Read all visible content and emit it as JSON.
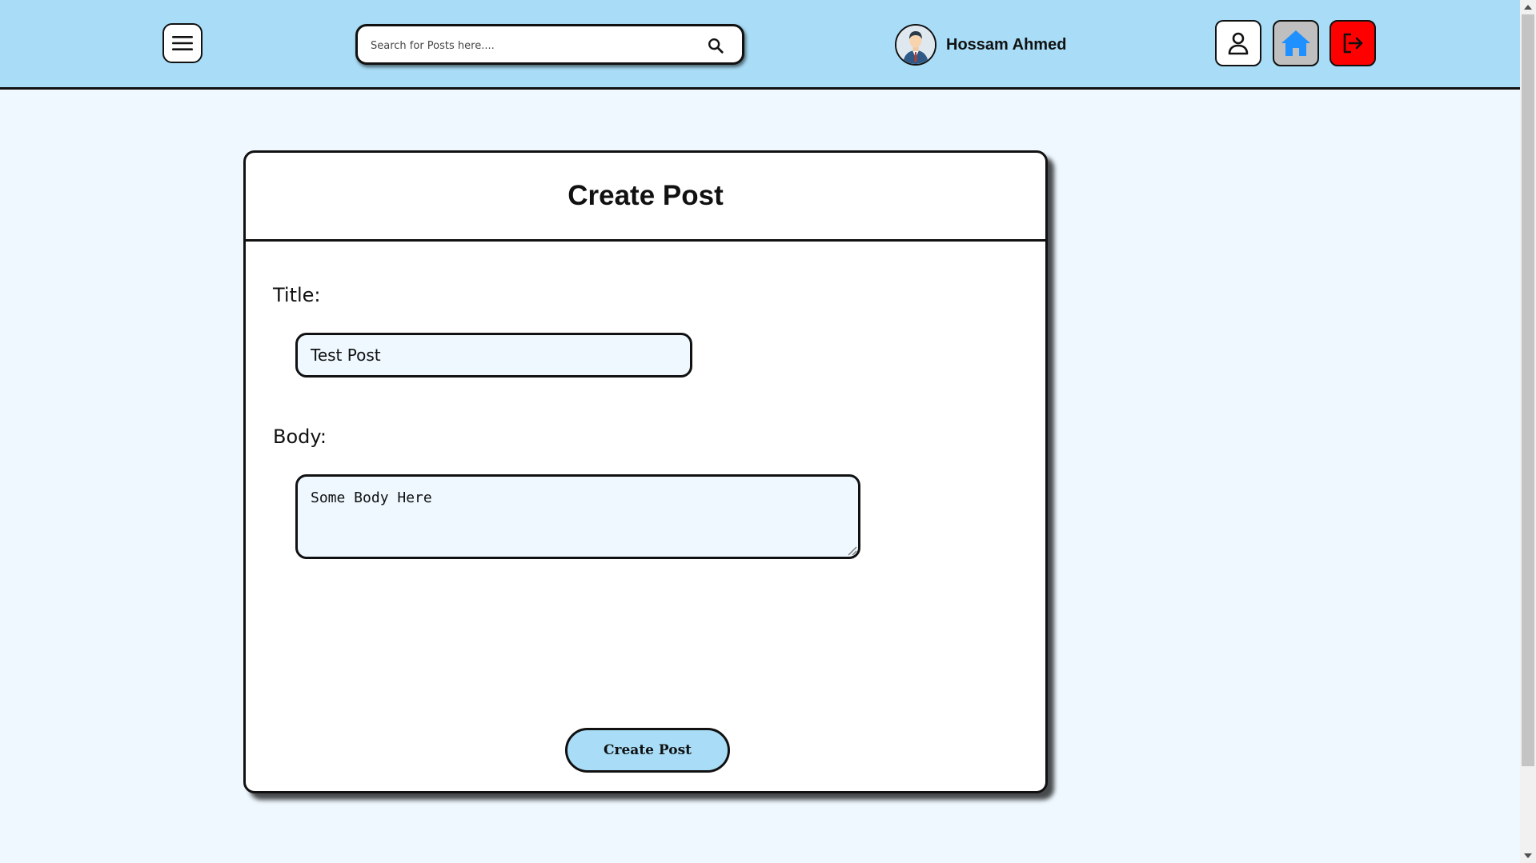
{
  "header": {
    "search": {
      "placeholder": "Search for Posts here....",
      "value": ""
    },
    "user": {
      "name": "Hossam Ahmed"
    },
    "icons": {
      "menu": "menu-icon",
      "search": "search-icon",
      "profile": "user-icon",
      "home": "home-icon",
      "logout": "logout-icon"
    },
    "colors": {
      "bar": "#a9ddf7",
      "home_icon": "#1e90ff",
      "logout_button": "#ff0000"
    }
  },
  "form": {
    "heading": "Create Post",
    "title_label": "Title:",
    "title_value": "Test Post",
    "body_label": "Body:",
    "body_value": "Some Body Here",
    "submit_label": "Create Post"
  }
}
